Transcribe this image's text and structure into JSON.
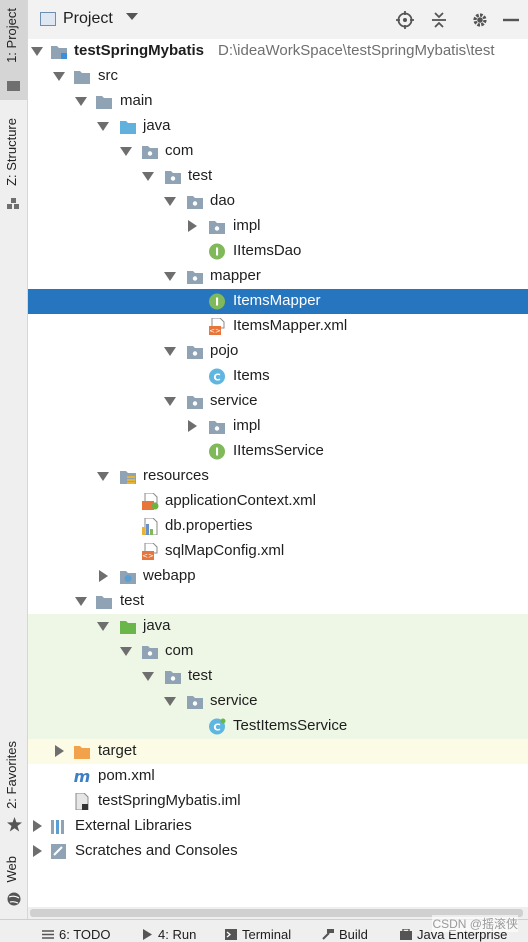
{
  "left_tabs": {
    "project": "1: Project",
    "structure": "Z: Structure",
    "favorites": "2: Favorites",
    "web": "Web"
  },
  "header": {
    "title": "Project",
    "dropdown_icon": "chevron-down-icon",
    "actions": [
      "locate-icon",
      "collapse-icon",
      "gear-icon",
      "hide-icon"
    ]
  },
  "tree": {
    "root": {
      "name": "testSpringMybatis",
      "path": "D:\\ideaWorkSpace\\testSpringMybatis\\test"
    },
    "src": "src",
    "main": "main",
    "java": "java",
    "com": "com",
    "test_pkg": "test",
    "dao": "dao",
    "dao_impl": "impl",
    "iitems_dao": "IItemsDao",
    "mapper": "mapper",
    "items_mapper": "ItemsMapper",
    "items_mapper_xml": "ItemsMapper.xml",
    "pojo": "pojo",
    "items": "Items",
    "service": "service",
    "service_impl": "impl",
    "iitems_service": "IItemsService",
    "resources": "resources",
    "app_context": "applicationContext.xml",
    "db_props": "db.properties",
    "sqlmap": "sqlMapConfig.xml",
    "webapp": "webapp",
    "test_dir": "test",
    "test_java": "java",
    "test_com": "com",
    "test_test": "test",
    "test_service": "service",
    "test_items_service": "TestItemsService",
    "target": "target",
    "pom": "pom.xml",
    "iml": "testSpringMybatis.iml",
    "ext_libs": "External Libraries",
    "scratches": "Scratches and Consoles"
  },
  "bottom": {
    "todo": "6: TODO",
    "run": "4: Run",
    "terminal": "Terminal",
    "build": "Build",
    "java_ee": "Java Enterprise"
  },
  "watermark": "CSDN @摇滚侠",
  "colors": {
    "selection": "#2675bf",
    "folder": "#8fa3b5",
    "source_folder": "#62b1dc",
    "interface": "#7fb95a",
    "class": "#5fb6e0",
    "excluded": "#f2a24b"
  }
}
